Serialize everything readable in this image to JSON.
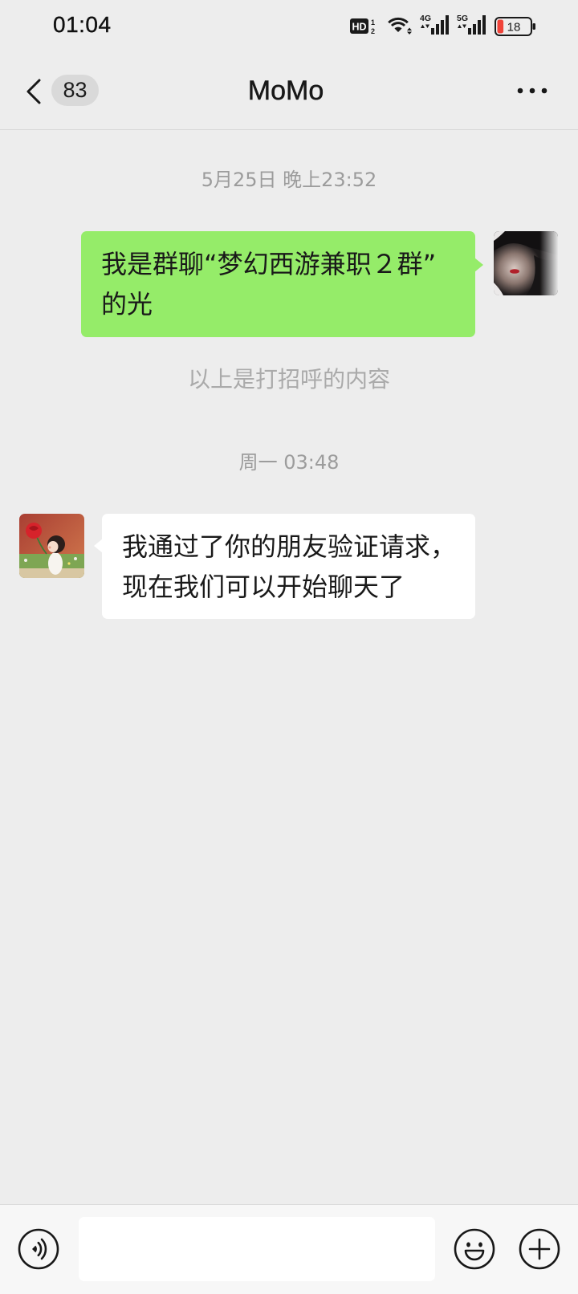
{
  "status_bar": {
    "time": "01:04",
    "hd": {
      "label": "HD",
      "sim_top": "1",
      "sim_bottom": "2"
    },
    "sim1_network": "4G",
    "sim2_network": "5G",
    "battery_level": "18"
  },
  "header": {
    "back_icon": "chevron-left-icon",
    "unread_count": "83",
    "title": "MoMo",
    "more_icon": "more-dots-icon"
  },
  "messages": [
    {
      "timestamp": "5月25日 晚上23:52"
    },
    {
      "sent": [
        "我是群聊“梦幻西游兼职２群”",
        "的光"
      ]
    },
    {
      "system_note": "以上是打招呼的内容"
    },
    {
      "timestamp": "周一 03:48"
    },
    {
      "received": [
        "我通过了你的朋友验证请求，",
        "现在我们可以开始聊天了"
      ]
    }
  ],
  "input_bar": {
    "voice_icon": "voice-icon",
    "message_value": "",
    "emoji_icon": "emoji-icon",
    "plus_icon": "plus-icon"
  },
  "colors": {
    "chat_background": "#EDEDED",
    "sent_bubble": "#95EC69",
    "received_bubble": "#FFFFFF",
    "input_bar_background": "#F7F7F7",
    "battery_low": "#F0443A"
  }
}
